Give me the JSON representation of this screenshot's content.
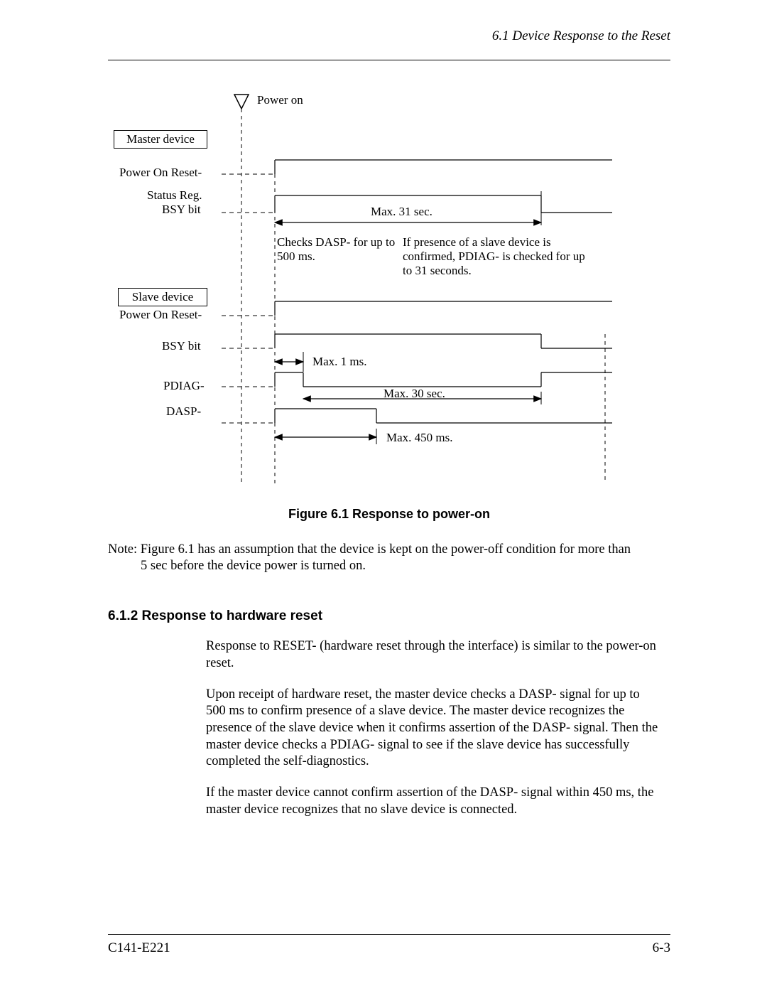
{
  "header": {
    "section_ref": "6.1  Device Response to the Reset"
  },
  "figure": {
    "labels": {
      "power_on": "Power on",
      "master_device": "Master device",
      "master_por": "Power On Reset-",
      "master_status_reg": "Status Reg.",
      "master_bsy": "BSY bit",
      "max31": "Max. 31 sec.",
      "checks_dasp": "Checks DASP- for up to 500 ms.",
      "slave_presence": "If presence of a slave device is confirmed, PDIAG- is checked for up to 31 seconds.",
      "slave_device": "Slave device",
      "slave_por": "Power On Reset-",
      "slave_bsy": "BSY bit",
      "max1ms": "Max. 1 ms.",
      "pdiag": "PDIAG-",
      "max30": "Max. 30 sec.",
      "dasp": "DASP-",
      "max450": "Max. 450 ms."
    },
    "caption": "Figure 6.1  Response to power-on"
  },
  "note": {
    "prefix": "Note:",
    "text_line1": "Figure 6.1 has an assumption that the device is kept on the power-off condition for more than",
    "text_line2": "5 sec before the device power is turned on."
  },
  "section": {
    "heading": "6.1.2  Response to hardware reset",
    "p1": "Response to RESET- (hardware reset through the interface) is similar to the power-on reset.",
    "p2": "Upon receipt of hardware reset, the master device checks a DASP- signal for up to 500 ms to confirm presence of a slave device. The master device recognizes the presence of the slave device when it confirms assertion of the DASP- signal. Then the master device checks a PDIAG- signal to see if the slave device has successfully completed the self-diagnostics.",
    "p3": "If the master device cannot confirm assertion of the DASP- signal within 450 ms, the master device recognizes that no slave device is connected."
  },
  "footer": {
    "doc_id": "C141-E221",
    "page": "6-3"
  }
}
